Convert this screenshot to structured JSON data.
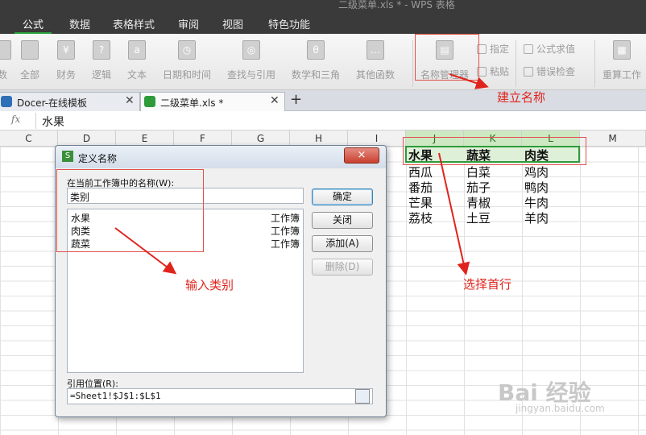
{
  "window": {
    "title": "二级菜单.xls * - WPS 表格"
  },
  "menu": {
    "items": [
      "公式",
      "数据",
      "表格样式",
      "审阅",
      "视图",
      "特色功能"
    ],
    "active": "公式"
  },
  "ribbon": {
    "buttons": [
      "数",
      "全部",
      "财务",
      "逻辑",
      "文本",
      "日期和时间",
      "查找与引用",
      "数学和三角",
      "其他函数",
      "名称管理器"
    ],
    "small": {
      "specify": "指定",
      "paste": "粘贴",
      "formula_eval": "公式求值",
      "error_check": "错误检查",
      "recalc": "重算工作"
    }
  },
  "tabs": [
    {
      "label": "Docer-在线模板"
    },
    {
      "label": "二级菜单.xls *"
    }
  ],
  "formula_bar": {
    "fx": "fx",
    "value": "水果"
  },
  "columns": [
    "C",
    "D",
    "E",
    "F",
    "G",
    "H",
    "I",
    "J",
    "K",
    "L",
    "M"
  ],
  "sheet": {
    "headers": [
      "水果",
      "蔬菜",
      "肉类"
    ],
    "rows": [
      [
        "西瓜",
        "白菜",
        "鸡肉"
      ],
      [
        "番茄",
        "茄子",
        "鸭肉"
      ],
      [
        "芒果",
        "青椒",
        "牛肉"
      ],
      [
        "荔枝",
        "土豆",
        "羊肉"
      ]
    ]
  },
  "dialog": {
    "title": "定义名称",
    "close": "×",
    "name_label": "在当前工作簿中的名称(W):",
    "name_value": "类别",
    "list": [
      {
        "name": "水果",
        "scope": "工作簿"
      },
      {
        "name": "肉类",
        "scope": "工作簿"
      },
      {
        "name": "蔬菜",
        "scope": "工作簿"
      }
    ],
    "buttons": {
      "ok": "确定",
      "close": "关闭",
      "add": "添加(A)",
      "delete": "删除(D)"
    },
    "ref_label": "引用位置(R):",
    "ref_value": "=Sheet1!$J$1:$L$1"
  },
  "annotations": {
    "define_name": "建立名称",
    "input_category": "输入类别",
    "select_first_row": "选择首行"
  },
  "watermark": {
    "main": "Bai 经验",
    "sub": "jingyan.baidu.com"
  },
  "colors": {
    "annotation": "#e0241d",
    "selection": "#2e9a3a",
    "menubar": "#3a3a3a"
  }
}
